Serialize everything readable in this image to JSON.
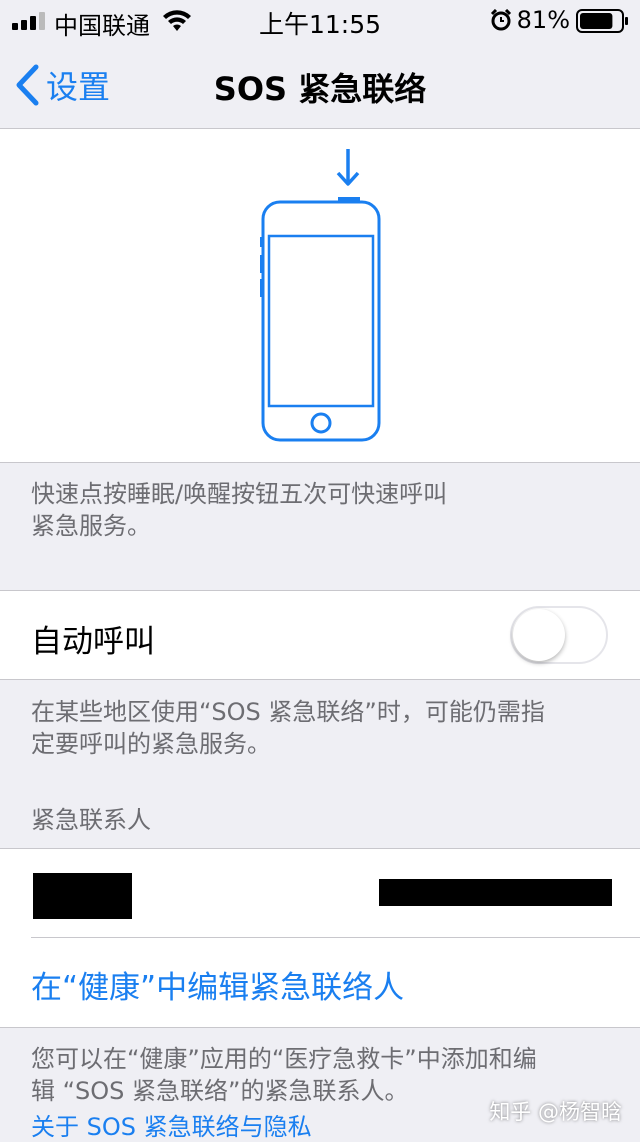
{
  "status_bar": {
    "carrier": "中国联通",
    "time": "上午11:55",
    "battery_percent": "81%",
    "battery_level": 0.81
  },
  "nav": {
    "back_label": "设置",
    "title": "SOS 紧急联络"
  },
  "illustration_caption": [
    "快速点按睡眠/唤醒按钮五次可快速呼叫",
    "紧急服务。"
  ],
  "auto_call": {
    "label": "自动呼叫",
    "enabled": false,
    "footer": [
      "在某些地区使用“SOS 紧急联络”时，可能仍需指",
      "定要呼叫的紧急服务。"
    ]
  },
  "contacts": {
    "section_header": "紧急联系人",
    "edit_link": "在“健康”中编辑紧急联络人",
    "footer": [
      "您可以在“健康”应用的“医疗急救卡”中添加和编",
      "辑 “SOS 紧急联络”的紧急联系人。"
    ],
    "privacy_link": "关于 SOS 紧急联络与隐私"
  },
  "watermark": "知乎 @杨智晗",
  "colors": {
    "accent": "#1a7ff0",
    "background": "#efeff4",
    "footnote": "#6d6d72"
  }
}
